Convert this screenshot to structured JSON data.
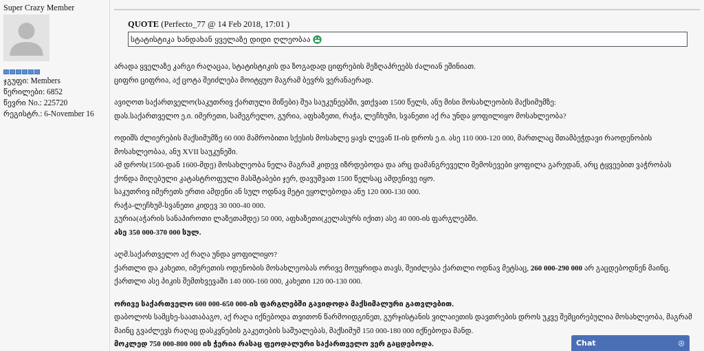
{
  "member": {
    "rank_title": "Super Crazy Member",
    "stats": [
      {
        "label": "ჯგუფი:",
        "value": "Members"
      },
      {
        "label": "წერილები:",
        "value": "6852"
      },
      {
        "label": "წევრი No.:",
        "value": "225720"
      },
      {
        "label": "რეგისტრ.:",
        "value": "6-November 16"
      }
    ]
  },
  "quote": {
    "label": "QUOTE",
    "meta": "(Perfecto_77 @ 14 Feb 2018, 17:01 )",
    "text": "სტატისტიკა ხანდახან ყველაზე დიდი ღლეობაა"
  },
  "post_blocks": [
    [
      {
        "text": "არადა ყველაზე კარგი რაღაცაა, სტატისტიკის და ზოგადად ციფრების მეზღაპრეებს ძალიან ეშინიათ.",
        "bold": false
      },
      {
        "text": "ციფრი ციფრია, აქ ცოტა შეიძლება მოიტყუო მაგრამ ბევრს ვერანაერად.",
        "bold": false
      }
    ],
    [
      {
        "text": "ავიღოთ საქართველო(საკუთრივ ქართული მიწები) შუა საუკუნეებში, ვთქვათ 1500 წელს, ანუ მისი მოსახლეობის მაქსიმუმზე:",
        "bold": false
      },
      {
        "text": "დას.საქართველო ე.ი. იმერეთი, სამეგრელო, გურია, აფხაზეთი, რაჭა, ლეჩხუმი, სვანეთი აქ რა უნდა ყოფილიყო მოსახლეობა?",
        "bold": false
      }
    ],
    [
      {
        "text": "ოდიშს ძლიერების მაქსიმუმზე 60 000 მამრობითი სქესის მოსახლე ყავს ლევან II-ის დროს ე.ი. ასე 110 000-120 000, მართლაც შთამბეჭდავი რაოდენობის მოსახლეობაა, ანუ XVII საუკუნეში.",
        "bold": false
      },
      {
        "text": "ამ დროს(1500-დან 1600-მდე) მოსახლეობა ნელა მაგრამ კიდევ იზრდებოდა და არც დამანგრეველი შემოსევები ყოფილა გარედან, არც ტყვეებით ვაჭრობას ქონდა მიღებული კატასტროფული მასშტაბები ჯერ, დავუშვათ 1500 წელსაც ამდენივე იყო.",
        "bold": false
      },
      {
        "text": "საკუთრივ იმერეთს ერთი ამდენი ან სულ ოდნავ მეტი ეყოლებოდა ანუ 120 000-130 000.",
        "bold": false
      },
      {
        "text": "რაჭა-ლეჩხუმ-სვანეთი კიდევ 30 000-40 000.",
        "bold": false
      },
      {
        "text": "გურია(აჭარის სანაპიროთი ლაზეთამდე) 50 000, აფხაზეთი(კელასურს იქით) ასე 40 000-ის ფარგლებში.",
        "bold": false
      },
      {
        "text": "ასე 350 000-370 000 სულ.",
        "bold": true
      }
    ],
    [
      {
        "text": "აღმ.საქართველო აქ რაღა უნდა ყოფილიყო?",
        "bold": false
      },
      {
        "text": "ქართლი და კახეთი, იმერეთის ოდენობის მოსახლეობას ორივე მოუყრიდა თავს, შეიძლება ქართლი ოდნავ მეტსაც, **260 000-290 000** არ გაცდებოდნენ მაინც.",
        "bold": false
      },
      {
        "text": "ქართლი ასე პიკის შემთხვევაში 140 000-160 000, კახეთი 120 00-130 000.",
        "bold": false
      }
    ],
    [
      {
        "text": "ორივე საქართველო 600 000-650 000-ის ფარგლებში გავიდოდა მაქსიმალური გათვლებით.",
        "bold": true
      },
      {
        "text": "დაბოლოს სამცხე-საათაბაგო, აქ რაღა იქნებოდა თვითონ წარმოიდგინეთ, გურჯისტანის ვილაიეთის დავთრების დროს უკვე შემცირებულია მოსახლეობა, მაგრამ მაინც გვაძლევს რაღაც დასკვნების გაკეთების საშუალებას, მაქსიმუმ 150 000-180 000 იქნებოდა მანდ.",
        "bold": false
      },
      {
        "text": "მოკლედ 750 000-800 000 ის ჭერია რასაც ფეოდალური საქართველო ვერ გაცდებოდა.",
        "bold": true
      }
    ]
  ],
  "chat": {
    "title": "Chat"
  }
}
